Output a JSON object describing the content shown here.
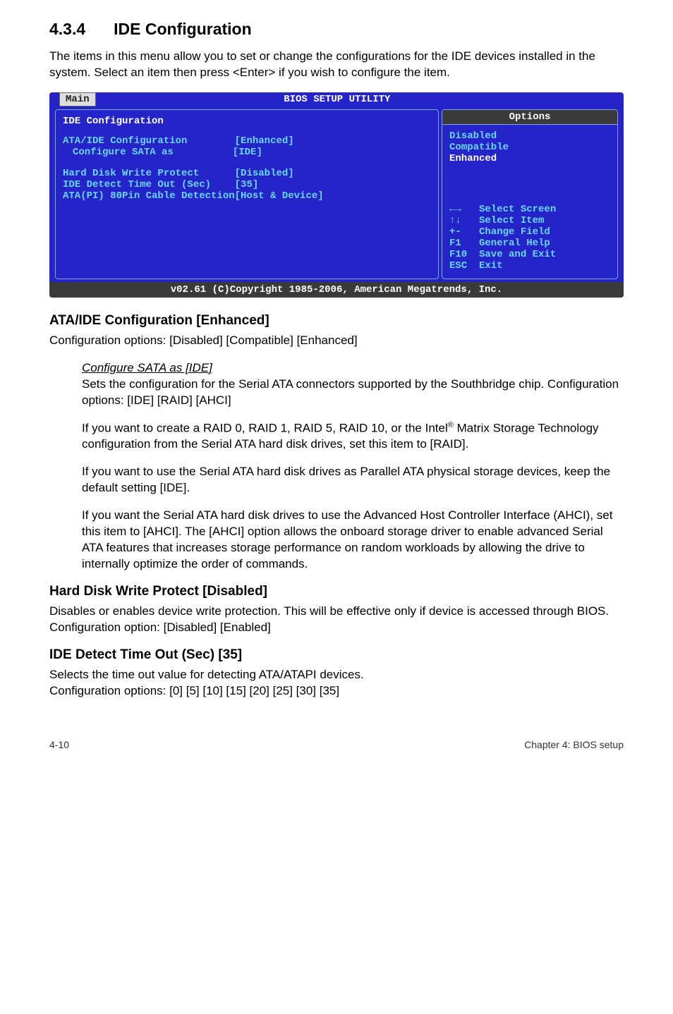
{
  "heading": {
    "number": "4.3.4",
    "title": "IDE Configuration"
  },
  "intro": "The items in this menu allow you to set or change the configurations for the IDE devices installed in the system. Select an item then press <Enter> if you wish to configure the item.",
  "bios": {
    "tab": "Main",
    "title": "BIOS SETUP UTILITY",
    "conf_title": "IDE Configuration",
    "rows": {
      "r1_label": "ATA/IDE Configuration",
      "r1_val": "[Enhanced]",
      "r2_label": "Configure SATA as",
      "r2_val": "[IDE]",
      "r3_label": "Hard Disk Write Protect",
      "r3_val": "[Disabled]",
      "r4_label": "IDE Detect Time Out (Sec)",
      "r4_val": "[35]",
      "r5": "ATA(PI) 80Pin Cable Detection[Host & Device]"
    },
    "options_header": "Options",
    "opts": {
      "o1": "Disabled",
      "o2": "Compatible",
      "o3": "Enhanced"
    },
    "nav": {
      "n1": "←→   Select Screen",
      "n2": "↑↓   Select Item",
      "n3": "+-   Change Field",
      "n4": "F1   General Help",
      "n5": "F10  Save and Exit",
      "n6": "ESC  Exit"
    },
    "footer": "v02.61 (C)Copyright 1985-2006, American Megatrends, Inc."
  },
  "s1": {
    "heading": "ATA/IDE Configuration [Enhanced]",
    "para": "Configuration options: [Disabled] [Compatible] [Enhanced]"
  },
  "ind1": {
    "title": "Configure SATA as [IDE]",
    "p": "Sets the configuration for the Serial ATA connectors supported by the Southbridge chip. Configuration options: [IDE] [RAID] [AHCI]"
  },
  "ind2": {
    "p_before": "If you want to create a RAID 0, RAID 1, RAID 5, RAID 10, or the Intel",
    "p_after": " Matrix Storage Technology configuration from the Serial ATA hard disk drives, set this item to [RAID]."
  },
  "ind3": {
    "p": "If you want to use the Serial ATA hard disk drives as Parallel ATA physical storage devices, keep the default setting [IDE]."
  },
  "ind4": {
    "p": "If you want the Serial ATA hard disk drives to use the Advanced Host Controller Interface (AHCI), set this item to [AHCI]. The [AHCI] option allows the onboard storage driver to enable advanced Serial ATA features that increases storage performance on random workloads by allowing the drive to internally optimize the order of commands."
  },
  "s2": {
    "heading": "Hard Disk Write Protect [Disabled]",
    "para": "Disables or enables device write protection. This will be effective only if device is accessed through BIOS. Configuration option: [Disabled] [Enabled]"
  },
  "s3": {
    "heading": "IDE Detect Time Out (Sec) [35]",
    "p1": "Selects the time out value for detecting ATA/ATAPI devices.",
    "p2": "Configuration options: [0] [5] [10] [15] [20] [25] [30] [35]"
  },
  "footer": {
    "left": "4-10",
    "right": "Chapter 4: BIOS setup"
  }
}
